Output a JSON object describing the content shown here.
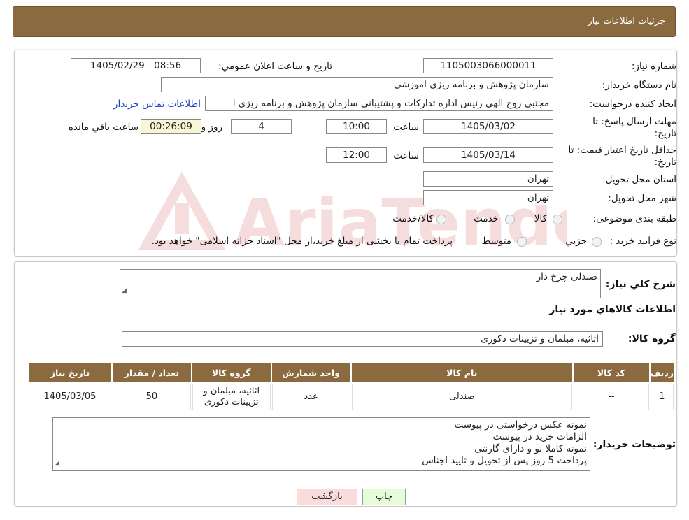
{
  "header": {
    "title": "جزئیات اطلاعات نیاز"
  },
  "form": {
    "need_number_label": "شماره نیاز:",
    "need_number": "1105003066000011",
    "announce_label": "تاريخ و ساعت اعلان عمومي:",
    "announce_value": "1405/02/29 - 08:56",
    "buyer_org_label": "نام دستگاه خريدار:",
    "buyer_org": "سازمان پژوهش و برنامه ریزی اموزشی",
    "creator_label": "ايجاد کننده درخواست:",
    "creator": "مجتبی روح الهی رئیس اداره تدارکات و پشتیبانی سازمان پژوهش و برنامه ریزی ا",
    "contact_link": "اطلاعات تماس خريدار",
    "deadline_label": "مهلت ارسال پاسخ: تا",
    "date_suffix": "تاريخ:",
    "deadline_date": "1405/03/02",
    "time_label": "ساعت",
    "deadline_time": "10:00",
    "days": "4",
    "days_label": "روز و",
    "remaining": "00:26:09",
    "remaining_label": "ساعت باقي مانده",
    "validity_label": "حداقل تاريخ اعتبار قيمت: تا",
    "validity_date": "1405/03/14",
    "validity_time": "12:00",
    "province_label": "استان محل تحويل:",
    "province": "تهران",
    "city_label": "شهر محل تحويل:",
    "city": "تهران",
    "category_label": "طبقه بندی موضوعی:",
    "category_options": [
      "کالا",
      "خدمت",
      "کالا/خدمت"
    ],
    "process_label": "نوع فرآيند خريد :",
    "process_options": [
      "جزيي",
      "متوسط"
    ],
    "process_note": "پرداخت تمام یا بخشی از مبلغ خرید،از محل \"اسناد خزانه اسلامی\" خواهد بود."
  },
  "details": {
    "summary_label": "شرح کلي نياز:",
    "summary": "صندلی چرخ دار",
    "goods_info_title": "اطلاعات کالاهاي مورد نياز",
    "group_label": "گروه کالا:",
    "group_value": "اثاثيه، مبلمان و تزيينات دکوری",
    "table": {
      "headers": [
        "رديف",
        "کد کالا",
        "نام کالا",
        "واحد شمارش",
        "گروه کالا",
        "تعداد / مقدار",
        "تاريخ نياز"
      ],
      "rows": [
        [
          "1",
          "--",
          "صندلی",
          "عدد",
          "اثاثيه، مبلمان و تزيينات دکوری",
          "50",
          "1405/03/05"
        ]
      ]
    },
    "buyer_notes_label": "توضيحات خريدار:",
    "buyer_notes": [
      "نمونه عکس درخواستی در پیوست",
      "الزامات خرید در پیوست",
      "نمونه کاملا نو و دارای گارنتی",
      "پرداخت 5 روز پس از تحویل و تایید اجناس"
    ]
  },
  "buttons": {
    "print": "چاپ",
    "back": "بازگشت"
  },
  "watermark": "AriaTender.neT",
  "colors": {
    "header": "#8c6a3f",
    "remaining_bg": "#f9f5d7",
    "print_bg": "#e6fbd8",
    "back_bg": "#fbdcdc",
    "link": "#1a3fc9"
  }
}
